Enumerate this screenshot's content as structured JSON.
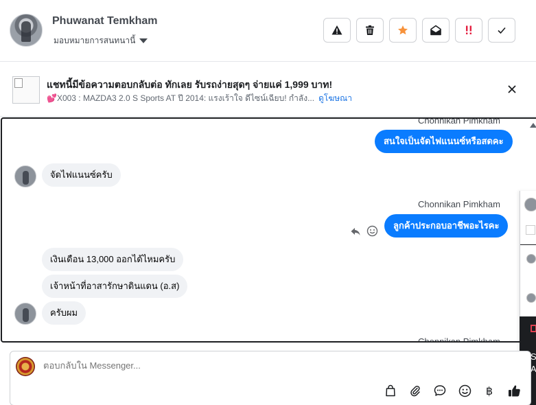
{
  "header": {
    "user_name": "Phuwanat Temkham",
    "assign_label": "มอบหมายการสนทนานี้",
    "actions": [
      {
        "name": "report",
        "icon": "warning-icon"
      },
      {
        "name": "delete",
        "icon": "trash-icon"
      },
      {
        "name": "star",
        "icon": "star-icon",
        "color": "#f7923b"
      },
      {
        "name": "mark-unread",
        "icon": "envelope-open-icon"
      },
      {
        "name": "spam",
        "icon": "spam-icon",
        "color": "#e41e3f"
      },
      {
        "name": "done",
        "icon": "check-icon"
      }
    ]
  },
  "ad": {
    "title": "แชทนี้มีข้อความตอบกลับต่อ ทักเลย รับรถง่ายสุดๆ จ่ายแค่ 1,999 บาท!",
    "subtitle": "💕X003 : MAZDA3 2.0 S Sports AT ปี 2014: แรงเร้าใจ ดีไซน์เฉียบ! กำลัง...",
    "link_label": "ดูโฆษณา"
  },
  "conversation": {
    "messages": [
      {
        "sender": "Chonnikan Pimkham",
        "text": "สนใจเป็นจัดไฟแนนซ์หรือสดคะ",
        "direction": "out"
      },
      {
        "text": "จัดไฟแนนซ์ครับ",
        "direction": "in"
      },
      {
        "sender": "Chonnikan Pimkham",
        "text": "ลูกค้าประกอบอาชีพอะไรคะ",
        "direction": "out"
      },
      {
        "text": "เงินเดือน 13,000 ออกได้ไหมครับ",
        "direction": "in"
      },
      {
        "text": "เจ้าหน้าที่อาสารักษาดินแดน (อ.ส)",
        "direction": "in"
      },
      {
        "text": "ครับผม",
        "direction": "in"
      },
      {
        "sender": "Chonnikan Pimkham",
        "direction": "out"
      }
    ]
  },
  "side_panel": {
    "dark_letters": [
      "S",
      "A"
    ]
  },
  "composer": {
    "placeholder": "ตอบกลับใน Messenger...",
    "tools": [
      "bag-icon",
      "paperclip-icon",
      "chat-bubble-icon",
      "emoji-icon",
      "baht-icon",
      "thumbs-up-icon"
    ],
    "baht_symbol": "฿"
  },
  "colors": {
    "accent": "#0a7cff",
    "link": "#1b74e4",
    "star": "#f7923b",
    "spam": "#e41e3f"
  }
}
